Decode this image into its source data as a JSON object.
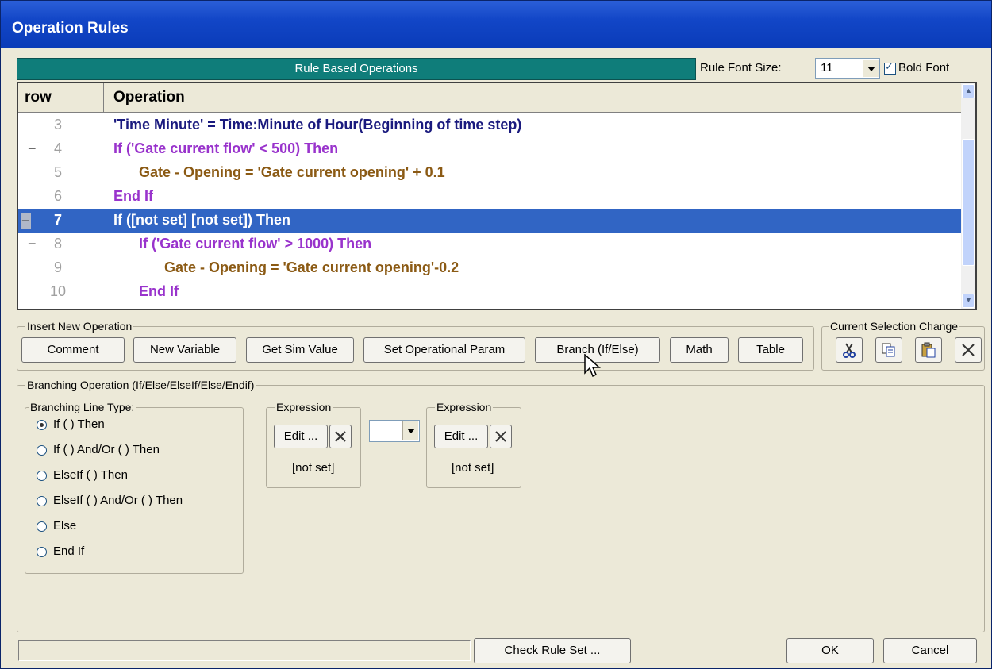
{
  "window": {
    "title": "Operation Rules"
  },
  "header": {
    "banner": "Rule Based Operations",
    "font_size_label": "Rule Font Size:",
    "font_size_value": "11",
    "bold_font_label": "Bold Font",
    "bold_font_checked": true
  },
  "grid": {
    "columns": [
      "row",
      "Operation"
    ],
    "rows": [
      {
        "num": "3",
        "text": "'Time Minute' = Time:Minute of Hour(Beginning of time step)",
        "indent": 0,
        "color": "#1a1a7e",
        "collapse": ""
      },
      {
        "num": "4",
        "text": "If ('Gate current flow' < 500) Then",
        "indent": 0,
        "color": "#9933cc",
        "collapse": "−"
      },
      {
        "num": "5",
        "text": "Gate - Opening = 'Gate current opening' + 0.1",
        "indent": 1,
        "color": "#8b5a14",
        "collapse": ""
      },
      {
        "num": "6",
        "text": "End If",
        "indent": 0,
        "color": "#9933cc",
        "collapse": ""
      },
      {
        "num": "7",
        "text": "If ([not set]  [not set]) Then",
        "indent": 0,
        "color": "#ffffff",
        "collapse": "−",
        "selected": true
      },
      {
        "num": "8",
        "text": "If ('Gate current flow' > 1000) Then",
        "indent": 1,
        "color": "#9933cc",
        "collapse": "−"
      },
      {
        "num": "9",
        "text": "Gate - Opening = 'Gate current opening'-0.2",
        "indent": 2,
        "color": "#8b5a14",
        "collapse": ""
      },
      {
        "num": "10",
        "text": "End If",
        "indent": 1,
        "color": "#9933cc",
        "collapse": ""
      }
    ]
  },
  "insert": {
    "legend": "Insert New Operation",
    "buttons": [
      "Comment",
      "New Variable",
      "Get Sim Value",
      "Set Operational Param",
      "Branch (If/Else)",
      "Math",
      "Table"
    ]
  },
  "selection": {
    "legend": "Current Selection Change",
    "icons": [
      "cut-icon",
      "copy-icon",
      "paste-icon",
      "delete-icon"
    ]
  },
  "branching": {
    "legend": "Branching Operation (If/Else/ElseIf/Else/Endif)",
    "line_type_legend": "Branching Line Type:",
    "options": [
      "If ( ) Then",
      "If ( ) And/Or ( ) Then",
      "ElseIf ( ) Then",
      "ElseIf ( ) And/Or ( ) Then",
      "Else",
      "End If"
    ],
    "selected_index": 0,
    "expr1": {
      "legend": "Expression",
      "edit": "Edit ...",
      "value": "[not set]"
    },
    "expr2": {
      "legend": "Expression",
      "edit": "Edit ...",
      "value": "[not set]"
    },
    "operator_value": ""
  },
  "footer": {
    "check": "Check Rule Set ...",
    "ok": "OK",
    "cancel": "Cancel"
  }
}
